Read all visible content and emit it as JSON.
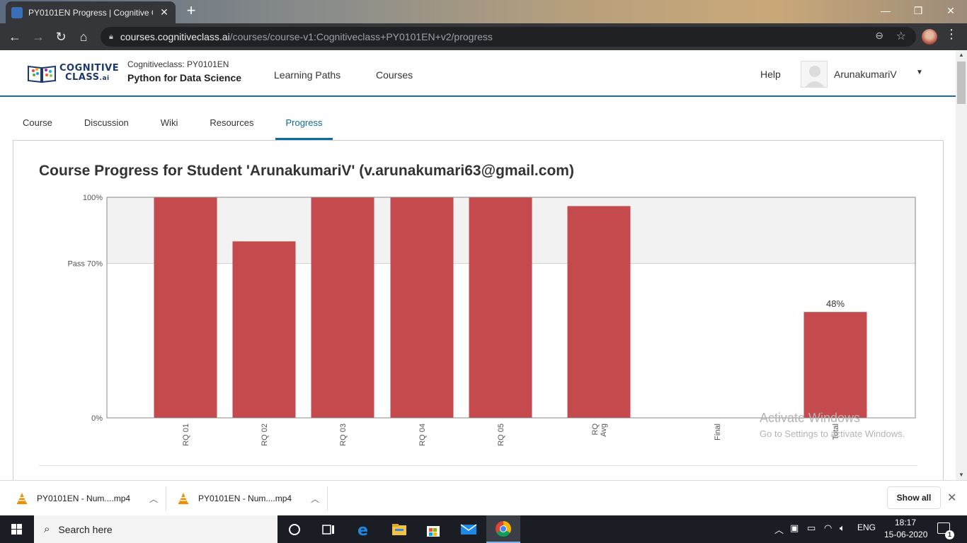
{
  "browser": {
    "tab_title": "PY0101EN Progress | Cognitive C",
    "url_host": "courses.cognitiveclass.ai",
    "url_path": "/courses/course-v1:Cognitiveclass+PY0101EN+v2/progress"
  },
  "site": {
    "logo_line1": "COGNITIVE",
    "logo_line2": "CLASS",
    "logo_suffix": ".ai",
    "course_org": "Cognitiveclass: PY0101EN",
    "course_name": "Python for Data Science",
    "nav": [
      "Learning Paths",
      "Courses"
    ],
    "help": "Help",
    "username": "ArunakumariV"
  },
  "course_tabs": [
    {
      "label": "Course",
      "active": false
    },
    {
      "label": "Discussion",
      "active": false
    },
    {
      "label": "Wiki",
      "active": false
    },
    {
      "label": "Resources",
      "active": false
    },
    {
      "label": "Progress",
      "active": true
    }
  ],
  "progress": {
    "title": "Course Progress for Student 'ArunakumariV' (v.arunakumari63@gmail.com)"
  },
  "chart_data": {
    "type": "bar",
    "categories": [
      "RQ 01",
      "RQ 02",
      "RQ 03",
      "RQ 04",
      "RQ 05",
      "RQ Avg",
      "Final",
      "Total"
    ],
    "values": [
      100,
      80,
      100,
      100,
      100,
      96,
      null,
      48
    ],
    "ylim": [
      0,
      100
    ],
    "ytick_labels": [
      "0%",
      "Pass 70%",
      "100%"
    ],
    "ytick_values": [
      0,
      70,
      100
    ],
    "pass_threshold": 70,
    "data_labels": {
      "Total": "48%"
    },
    "bar_color": "#c44a4d",
    "pass_band_color": "#f2f2f2"
  },
  "watermark": {
    "line1": "Activate Windows",
    "line2": "Go to Settings to activate Windows."
  },
  "downloads": {
    "items": [
      "PY0101EN - Num....mp4",
      "PY0101EN - Num....mp4"
    ],
    "show_all": "Show all"
  },
  "taskbar": {
    "search_placeholder": "Search here",
    "lang": "ENG",
    "time": "18:17",
    "date": "15-06-2020",
    "notification_count": "1"
  }
}
